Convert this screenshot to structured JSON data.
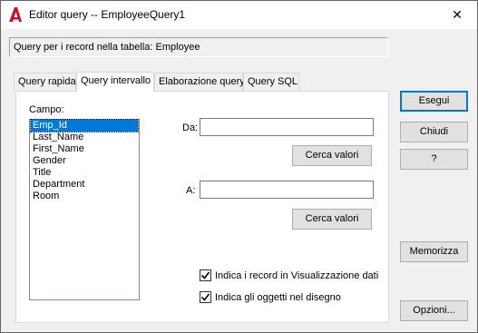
{
  "window": {
    "title": "Editor query -- EmployeeQuery1",
    "close_glyph": "✕"
  },
  "info": {
    "text": "Query per i record nella tabella:  Employee"
  },
  "tabs": [
    {
      "label": "Query rapida",
      "active": false
    },
    {
      "label": "Query intervallo",
      "active": true
    },
    {
      "label": "Elaborazione query",
      "active": false
    },
    {
      "label": "Query SQL",
      "active": false
    }
  ],
  "panel": {
    "campo_label": "Campo:",
    "fields": [
      "Emp_Id",
      "Last_Name",
      "First_Name",
      "Gender",
      "Title",
      "Department",
      "Room"
    ],
    "selected_field": "Emp_Id",
    "da_label": "Da:",
    "da_value": "",
    "cerca_da": "Cerca valori",
    "a_label": "A:",
    "a_value": "",
    "cerca_a": "Cerca valori",
    "check_visualizzazione": {
      "label": "Indica i record in Visualizzazione dati",
      "checked": true
    },
    "check_disegno": {
      "label": "Indica gli oggetti nel disegno",
      "checked": true
    }
  },
  "buttons": {
    "esegui": "Esegui",
    "chiudi": "Chiudi",
    "help": "?",
    "memorizza": "Memorizza",
    "opzioni": "Opzioni..."
  },
  "colors": {
    "accent": "#0078d7",
    "app_icon": "#c8102e"
  }
}
